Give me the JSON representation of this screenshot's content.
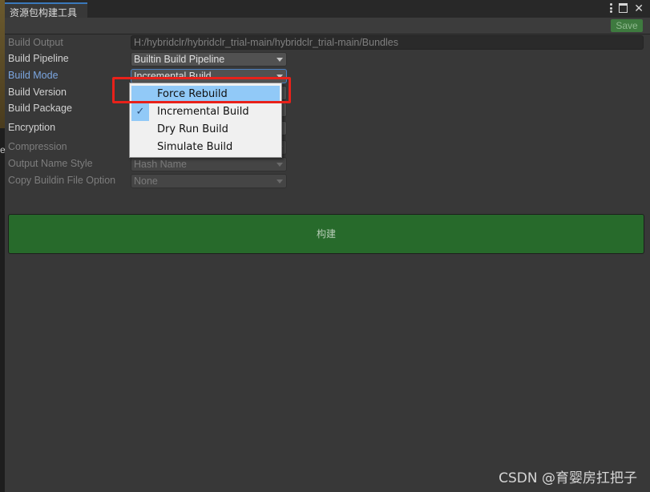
{
  "window": {
    "tab_title": "资源包构建工具",
    "icons": [
      "kebab-menu-icon",
      "maximize-icon",
      "close-icon"
    ]
  },
  "toolbar": {
    "save_label": "Save"
  },
  "form": {
    "build_output": {
      "label": "Build Output",
      "value": "H:/hybridclr/hybridclr_trial-main/hybridclr_trial-main/Bundles"
    },
    "build_pipeline": {
      "label": "Build Pipeline",
      "value": "Builtin Build Pipeline"
    },
    "build_mode": {
      "label": "Build Mode",
      "value": "Incremental Build"
    },
    "build_version": {
      "label": "Build Version"
    },
    "build_package": {
      "label": "Build Package"
    },
    "encryption": {
      "label": "Encryption"
    },
    "compression": {
      "label": "Compression"
    },
    "output_name_style": {
      "label": "Output Name Style",
      "value": "Hash Name"
    },
    "copy_buildin_file_option": {
      "label": "Copy Buildin File Option",
      "value": "None"
    }
  },
  "build_button": {
    "label": "构建"
  },
  "dropdown": {
    "options": [
      {
        "label": "Force Rebuild",
        "checked": false,
        "hovered": true
      },
      {
        "label": "Incremental Build",
        "checked": true,
        "hovered": false
      },
      {
        "label": "Dry Run Build",
        "checked": false,
        "hovered": false
      },
      {
        "label": "Simulate Build",
        "checked": false,
        "hovered": false
      }
    ],
    "check_glyph": "✓"
  },
  "left_edge_glyph": "e",
  "watermark": "CSDN @育婴房扛把子",
  "colors": {
    "accent_blue": "#3a79bb",
    "build_green": "#276a2b",
    "save_green": "#3e7a3f",
    "highlight_red": "#e8211a",
    "hover_blue": "#91c9f7"
  }
}
